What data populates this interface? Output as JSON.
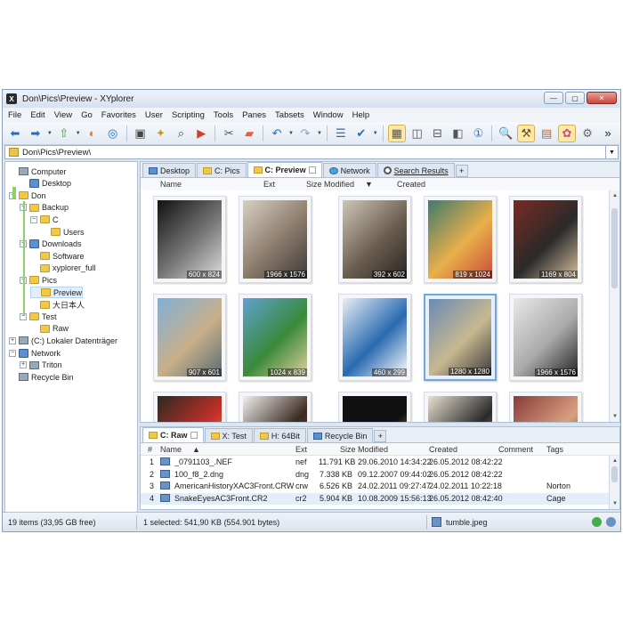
{
  "window": {
    "title": "Don\\Pics\\Preview - XYplorer",
    "app_letter": "X",
    "controls": [
      "—",
      "▢",
      "✕"
    ]
  },
  "menu": [
    "File",
    "Edit",
    "View",
    "Go",
    "Favorites",
    "User",
    "Scripting",
    "Tools",
    "Panes",
    "Tabsets",
    "Window",
    "Help"
  ],
  "toolbar": {
    "icons": [
      "back-arrow-icon",
      "forward-arrow-icon",
      "up-folder-icon",
      "paint-icon",
      "target-icon",
      "computer-icon",
      "folder-star-icon",
      "search-folder-icon",
      "play-icon",
      "cut-icon",
      "eraser-icon",
      "undo-icon",
      "redo-icon",
      "list-view-icon",
      "check-icon",
      "thumbnails-icon",
      "dual-pane-icon",
      "horizontal-pane-icon",
      "vertical-pane-icon",
      "one-pane-icon",
      "find-icon",
      "tools-icon",
      "briefcase-icon",
      "palette-icon",
      "gear-icon"
    ],
    "more": "»"
  },
  "address": {
    "path": "Don\\Pics\\Preview\\"
  },
  "tree": [
    {
      "label": "Computer",
      "icon": "computer",
      "level": 0,
      "expander": ""
    },
    {
      "label": "Desktop",
      "icon": "blue",
      "level": 1,
      "expander": ""
    },
    {
      "label": "Don",
      "icon": "folder",
      "level": 0,
      "expander": "−"
    },
    {
      "label": "Backup",
      "icon": "folder",
      "level": 1,
      "expander": "−"
    },
    {
      "label": "C",
      "icon": "folder",
      "level": 2,
      "expander": "−"
    },
    {
      "label": "Users",
      "icon": "folder",
      "level": 3,
      "expander": ""
    },
    {
      "label": "Downloads",
      "icon": "blue",
      "level": 1,
      "expander": "−"
    },
    {
      "label": "Software",
      "icon": "folder",
      "level": 2,
      "expander": ""
    },
    {
      "label": "xyplorer_full",
      "icon": "folder",
      "level": 2,
      "expander": ""
    },
    {
      "label": "Pics",
      "icon": "folder",
      "level": 1,
      "expander": "−"
    },
    {
      "label": "Preview",
      "icon": "folder",
      "level": 2,
      "expander": "",
      "selected": true
    },
    {
      "label": "大日本人",
      "icon": "folder",
      "level": 2,
      "expander": ""
    },
    {
      "label": "Test",
      "icon": "folder",
      "level": 1,
      "expander": "−"
    },
    {
      "label": "Raw",
      "icon": "folder",
      "level": 2,
      "expander": ""
    },
    {
      "label": "(C:) Lokaler Datenträger",
      "icon": "drive",
      "level": 0,
      "expander": "+"
    },
    {
      "label": "Network",
      "icon": "blue",
      "level": 0,
      "expander": "−"
    },
    {
      "label": "Triton",
      "icon": "drive",
      "level": 1,
      "expander": "+"
    },
    {
      "label": "Recycle Bin",
      "icon": "drive",
      "level": 0,
      "expander": ""
    }
  ],
  "top_tabs": [
    {
      "label": "Desktop",
      "icon": "blue",
      "active": false,
      "close": false
    },
    {
      "label": "C: Pics",
      "icon": "folder",
      "active": false,
      "close": false
    },
    {
      "label": "C: Preview",
      "icon": "folder",
      "active": true,
      "close": true
    },
    {
      "label": "Network",
      "icon": "globe",
      "active": false,
      "close": false
    },
    {
      "label": "Search Results",
      "icon": "lens",
      "active": false,
      "close": false
    }
  ],
  "top_columns": {
    "name": "Name",
    "ext": "Ext",
    "size": "Size",
    "modified": "Modified",
    "sort": "▼",
    "created": "Created"
  },
  "thumbnails": [
    {
      "dim": "600 x 824",
      "colors": [
        "#111",
        "#777",
        "#ddd"
      ]
    },
    {
      "dim": "1966 x 1576",
      "colors": [
        "#d8d0c2",
        "#8a7a6a",
        "#3a3a3a"
      ]
    },
    {
      "dim": "392 x 602",
      "colors": [
        "#cfc6b8",
        "#6a5e50",
        "#2a2520"
      ]
    },
    {
      "dim": "819 x 1024",
      "colors": [
        "#3f7a6e",
        "#e8b04a",
        "#c94b3a"
      ]
    },
    {
      "dim": "1169 x 804",
      "colors": [
        "#7a2a22",
        "#2a2a2a",
        "#d8c0a0"
      ]
    },
    {
      "dim": "907 x 601",
      "colors": [
        "#7fb0d8",
        "#c8b08a",
        "#5a6a70"
      ]
    },
    {
      "dim": "1024 x 839",
      "colors": [
        "#5fa0d0",
        "#3a8a3a",
        "#e0d0a0"
      ]
    },
    {
      "dim": "460 x 299",
      "colors": [
        "#e8eef4",
        "#2a6ab0",
        "#ffffff"
      ]
    },
    {
      "dim": "1280 x 1280",
      "colors": [
        "#6a8ab8",
        "#c8b890",
        "#3a3a3a"
      ]
    },
    {
      "dim": "1966 x 1576",
      "colors": [
        "#e8e8e8",
        "#aaa",
        "#222"
      ]
    },
    {
      "dim": "",
      "colors": [
        "#2a2a20",
        "#c8302a",
        "#e8c040"
      ]
    },
    {
      "dim": "",
      "colors": [
        "#f0f0f0",
        "#3a2a20",
        "#8a6a50"
      ]
    },
    {
      "dim": "",
      "colors": [
        "#111",
        "#111",
        "#e8d050"
      ]
    },
    {
      "dim": "",
      "colors": [
        "#e8e0d0",
        "#2a2a2a",
        "#c8b080"
      ]
    },
    {
      "dim": "",
      "colors": [
        "#8a3a3a",
        "#d8a080",
        "#3a2a2a"
      ]
    }
  ],
  "bottom_tabs": [
    {
      "label": "C: Raw",
      "icon": "folder",
      "active": true,
      "close": true
    },
    {
      "label": "X: Test",
      "icon": "folder",
      "active": false,
      "close": false
    },
    {
      "label": "H: 64Bit",
      "icon": "folder",
      "active": false,
      "close": false
    },
    {
      "label": "Recycle Bin",
      "icon": "blue",
      "active": false,
      "close": false
    }
  ],
  "list_columns": {
    "num": "#",
    "name": "Name",
    "sort": "▲",
    "ext": "Ext",
    "size": "Size",
    "modified": "Modified",
    "created": "Created",
    "comment": "Comment",
    "tags": "Tags"
  },
  "files": [
    {
      "num": "1",
      "name": "_0791103_.NEF",
      "ext": "nef",
      "size": "11.791 KB",
      "modified": "29.06.2010 14:34:22",
      "created": "26.05.2012 08:42:22",
      "comment": "",
      "tags": ""
    },
    {
      "num": "2",
      "name": "100_f8_2.dng",
      "ext": "dng",
      "size": "7.338 KB",
      "modified": "09.12.2007 09:44:02",
      "created": "26.05.2012 08:42:22",
      "comment": "",
      "tags": ""
    },
    {
      "num": "3",
      "name": "AmericanHistoryXAC3Front.CRW",
      "ext": "crw",
      "size": "6.526 KB",
      "modified": "24.02.2011 09:27:47",
      "created": "24.02.2011 10:22:18",
      "comment": "",
      "tags": "Norton"
    },
    {
      "num": "4",
      "name": "SnakeEyesAC3Front.CR2",
      "ext": "cr2",
      "size": "5.904 KB",
      "modified": "10.08.2009 15:56:13",
      "created": "26.05.2012 08:42:40",
      "comment": "",
      "tags": "Cage"
    }
  ],
  "status": {
    "items": "19 items (33,95 GB free)",
    "selected": "1 selected: 541,90 KB (554.901 bytes)",
    "file": "tumble.jpeg"
  },
  "colors": {
    "accent": "#6ea6dd",
    "tree_line": "#8ed168",
    "folder": "#f0c94b"
  }
}
